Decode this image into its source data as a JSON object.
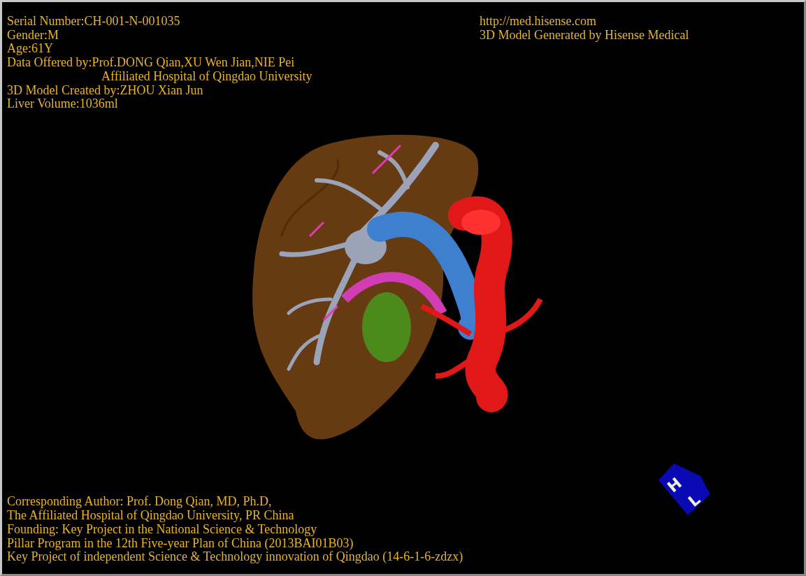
{
  "info_top_left": [
    {
      "text": "Serial Number:CH-001-N-001035",
      "kind": "line"
    },
    {
      "text": "Gender:M",
      "kind": "line"
    },
    {
      "text": "Age:61Y",
      "kind": "line"
    },
    {
      "text": "Data Offered by:Prof.DONG Qian,XU Wen Jian,NIE Pei",
      "kind": "line"
    },
    {
      "text": "Affiliated Hospital of Qingdao University",
      "kind": "continuation"
    },
    {
      "text": "3D Model Created by:ZHOU Xian Jun",
      "kind": "line"
    },
    {
      "text": "Liver Volume:1036ml",
      "kind": "line"
    }
  ],
  "info_top_right": [
    "http://med.hisense.com",
    "3D Model Generated by Hisense Medical"
  ],
  "orientation_cube": {
    "labels": [
      "H",
      "L"
    ]
  },
  "info_bottom": [
    "Corresponding Author: Prof. Dong Qian, MD, Ph.D,",
    "The Affiliated Hospital of Qingdao University, PR China",
    "Founding: Key Project in the National Science & Technology",
    "Pillar Program in the 12th Five-year Plan of China (2013BAI01B03)",
    "Key Project of independent Science & Technology innovation of Qingdao (14-6-1-6-zdzx)"
  ]
}
